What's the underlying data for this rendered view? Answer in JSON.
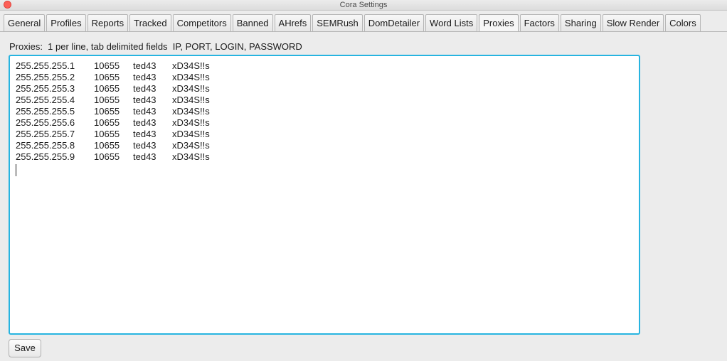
{
  "window": {
    "title": "Cora Settings"
  },
  "tabs": [
    {
      "label": "General"
    },
    {
      "label": "Profiles"
    },
    {
      "label": "Reports"
    },
    {
      "label": "Tracked"
    },
    {
      "label": "Competitors"
    },
    {
      "label": "Banned"
    },
    {
      "label": "AHrefs"
    },
    {
      "label": "SEMRush"
    },
    {
      "label": "DomDetailer"
    },
    {
      "label": "Word Lists"
    },
    {
      "label": "Proxies",
      "active": true
    },
    {
      "label": "Factors"
    },
    {
      "label": "Sharing"
    },
    {
      "label": "Slow Render"
    },
    {
      "label": "Colors"
    }
  ],
  "proxies": {
    "hint": "Proxies:  1 per line, tab delimited fields  IP, PORT, LOGIN, PASSWORD",
    "rows": [
      [
        "255.255.255.1",
        "10655",
        "ted43",
        "xD34S!!s"
      ],
      [
        "255.255.255.2",
        "10655",
        "ted43",
        "xD34S!!s"
      ],
      [
        "255.255.255.3",
        "10655",
        "ted43",
        "xD34S!!s"
      ],
      [
        "255.255.255.4",
        "10655",
        "ted43",
        "xD34S!!s"
      ],
      [
        "255.255.255.5",
        "10655",
        "ted43",
        "xD34S!!s"
      ],
      [
        "255.255.255.6",
        "10655",
        "ted43",
        "xD34S!!s"
      ],
      [
        "255.255.255.7",
        "10655",
        "ted43",
        "xD34S!!s"
      ],
      [
        "255.255.255.8",
        "10655",
        "ted43",
        "xD34S!!s"
      ],
      [
        "255.255.255.9",
        "10655",
        "ted43",
        "xD34S!!s"
      ]
    ]
  },
  "buttons": {
    "save": "Save"
  },
  "colors": {
    "focus_border": "#27b4e0",
    "close_button": "#fc5f57"
  }
}
